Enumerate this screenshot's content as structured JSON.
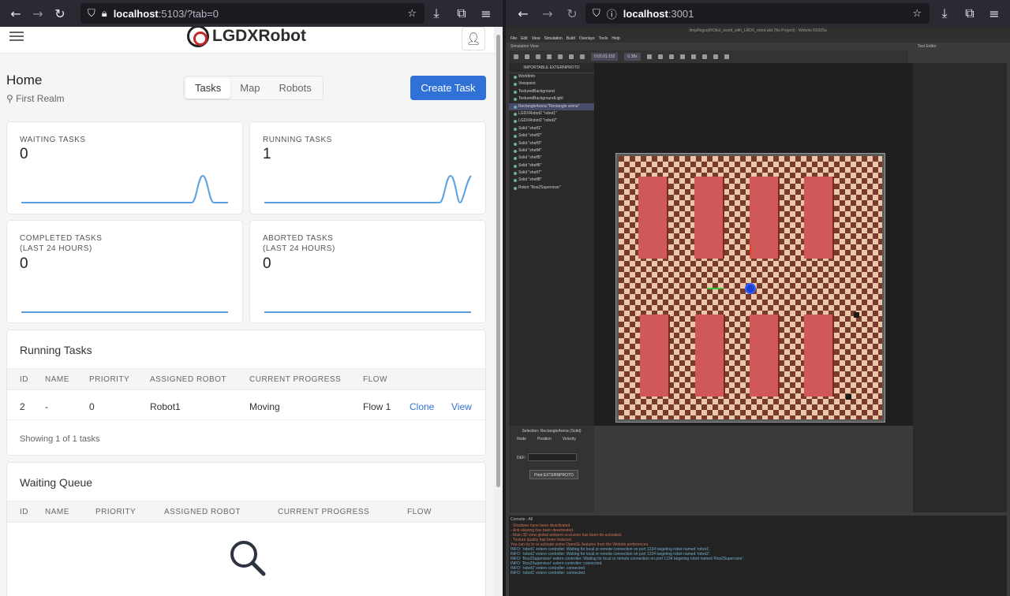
{
  "left_browser": {
    "url_host": "localhost",
    "url_path": ":5103/?tab=0"
  },
  "right_browser": {
    "url_host": "localhost",
    "url_path": ":3001"
  },
  "app": {
    "brand": "LGDXRobot",
    "page_title": "Home",
    "realm": "First Realm",
    "tabs": [
      {
        "label": "Tasks"
      },
      {
        "label": "Map"
      },
      {
        "label": "Robots"
      }
    ],
    "create_label": "Create Task",
    "stats": [
      {
        "label": "WAITING TASKS",
        "value": "0"
      },
      {
        "label": "RUNNING TASKS",
        "value": "1"
      },
      {
        "label": "COMPLETED TASKS\n(LAST 24 HOURS)",
        "value": "0"
      },
      {
        "label": "ABORTED TASKS\n(LAST 24 HOURS)",
        "value": "0"
      }
    ],
    "running": {
      "title": "Running Tasks",
      "headers": [
        "ID",
        "NAME",
        "PRIORITY",
        "ASSIGNED ROBOT",
        "CURRENT PROGRESS",
        "FLOW"
      ],
      "row": {
        "id": "2",
        "name": "-",
        "priority": "0",
        "robot": "Robot1",
        "progress": "Moving",
        "flow": "Flow 1",
        "clone": "Clone",
        "view": "View"
      },
      "footer": "Showing 1 of 1 tasks"
    },
    "waiting": {
      "title": "Waiting Queue",
      "headers": [
        "ID",
        "NAME",
        "PRIORITY",
        "ASSIGNED ROBOT",
        "CURRENT PROGRESS",
        "FLOW"
      ]
    }
  },
  "webots": {
    "title": "/tmp/lingoq/RObot_world_with_LRDX_robot.wbt (No Project) - Webots R2025a",
    "menu": [
      "File",
      "Edit",
      "View",
      "Simulation",
      "Build",
      "Overlays",
      "Tools",
      "Help"
    ],
    "sim_view": "Simulation View",
    "text_editor": "Text Editor",
    "clock": "0:01:01:152",
    "speed": "0.38x",
    "tree_header": "IMPORTABLE EXTERNPROTO",
    "tree": [
      "WorldInfo",
      "Viewpoint",
      "TexturedBackground",
      "TexturedBackgroundLight",
      "RectangleArena \"Rectangle arena\"",
      "LGDXRobot2 \"robot1\"",
      "LGDXRobot2 \"robot2\"",
      "Solid \"shelf1\"",
      "Solid \"shelf2\"",
      "Solid \"shelf3\"",
      "Solid \"shelf4\"",
      "Solid \"shelf5\"",
      "Solid \"shelf6\"",
      "Solid \"shelf7\"",
      "Solid \"shelf8\"",
      "Robot \"Ros2Supervisor\""
    ],
    "selection": "Selection: RectangleArena (Solid)",
    "sel_tabs": [
      "Node",
      "Position",
      "Velocity"
    ],
    "def_label": "DEF:",
    "print_btn": "Print EXTERNPROTO",
    "console_header": "Console - All",
    "console": [
      {
        "t": "- Shadows have been deactivated.",
        "c": "red"
      },
      {
        "t": "- Anti-aliasing has been deactivated.",
        "c": "red"
      },
      {
        "t": "- Main 3D view global ambient occlusion has been de-activated.",
        "c": "red"
      },
      {
        "t": "- Texture quality has been reduced.",
        "c": "red"
      },
      {
        "t": "You can try to re-activate some OpenGL features from the Webots preferences.",
        "c": "red"
      },
      {
        "t": "INFO: 'robot1' extern controller: Waiting for local or remote connection on port 1234 targeting robot named 'robot1'.",
        "c": "cyan"
      },
      {
        "t": "INFO: 'robot2' extern controller: Waiting for local or remote connection on port 1234 targeting robot named 'robot2'.",
        "c": "cyan"
      },
      {
        "t": "INFO: 'Ros2Supervisor' extern controller: Waiting for local or remote connection on port 1234 targeting robot named 'Ros2Supervisor'.",
        "c": "cyan"
      },
      {
        "t": "INFO: 'Ros2Supervisor' extern controller: connected.",
        "c": "cyan"
      },
      {
        "t": "INFO: 'robot2' extern controller: connected.",
        "c": "cyan"
      },
      {
        "t": "INFO: 'robot1' extern controller: connected.",
        "c": "cyan"
      }
    ]
  }
}
